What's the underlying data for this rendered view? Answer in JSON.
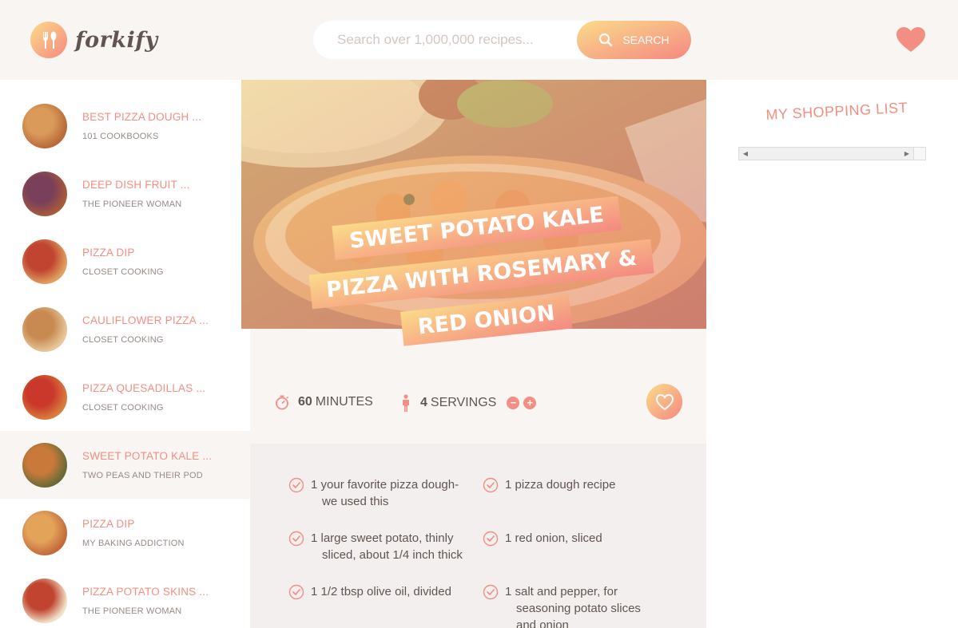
{
  "header": {
    "logo_text": "forkify",
    "search_placeholder": "Search over 1,000,000 recipes...",
    "search_button": "SEARCH",
    "likes_icon": "heart-icon"
  },
  "results": [
    {
      "title": "BEST PIZZA DOUGH ...",
      "author": "101 COOKBOOKS",
      "active": false
    },
    {
      "title": "DEEP DISH FRUIT ...",
      "author": "THE PIONEER WOMAN",
      "active": false
    },
    {
      "title": "PIZZA DIP",
      "author": "CLOSET COOKING",
      "active": false
    },
    {
      "title": "CAULIFLOWER PIZZA ...",
      "author": "CLOSET COOKING",
      "active": false
    },
    {
      "title": "PIZZA QUESADILLAS ...",
      "author": "CLOSET COOKING",
      "active": false
    },
    {
      "title": "SWEET POTATO KALE ...",
      "author": "TWO PEAS AND THEIR POD",
      "active": true
    },
    {
      "title": "PIZZA DIP",
      "author": "MY BAKING ADDICTION",
      "active": false
    },
    {
      "title": "PIZZA POTATO SKINS ...",
      "author": "THE PIONEER WOMAN",
      "active": false
    }
  ],
  "recipe": {
    "title_lines": [
      "SWEET POTATO KALE",
      "PIZZA WITH ROSEMARY &",
      "RED ONION"
    ],
    "time_value": "60",
    "time_unit": "MINUTES",
    "servings_value": "4",
    "servings_unit": "SERVINGS",
    "ingredients_left": [
      "1 your favorite pizza dough- we used this",
      "1 large sweet potato, thinly sliced, about 1/4 inch thick",
      "1 1/2 tbsp olive oil, divided"
    ],
    "ingredients_right": [
      "1 pizza dough recipe",
      "1 red onion, sliced",
      "1 salt and pepper, for seasoning potato slices and onion"
    ]
  },
  "shopping": {
    "title": "MY SHOPPING LIST"
  },
  "colors": {
    "accent": "#f38e82",
    "gradient_start": "#fbdb89",
    "gradient_end": "#f48982",
    "background_light": "#f9f5f3"
  }
}
